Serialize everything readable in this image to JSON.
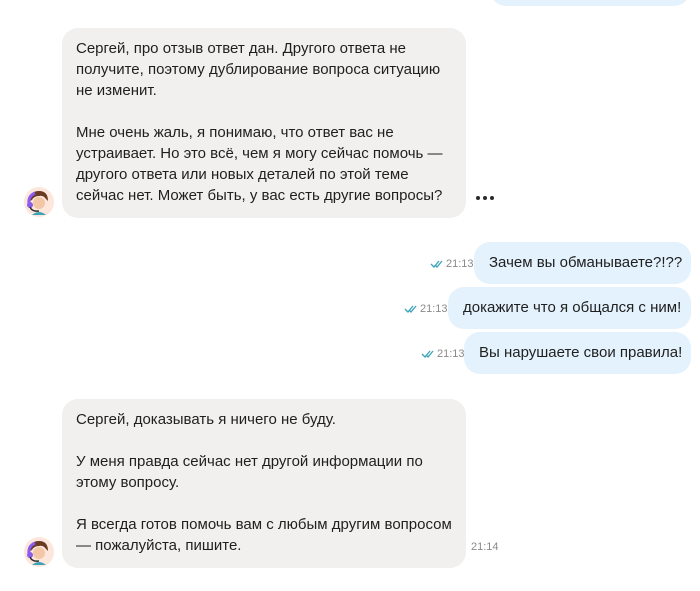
{
  "colors": {
    "incoming_bubble": "#f1f0ee",
    "outgoing_bubble": "#e3f2fc",
    "read_check": "#3aa3b8",
    "timestamp": "#8a8a8a"
  },
  "messages": [
    {
      "direction": "in",
      "text": "Сергей, про отзыв ответ дан. Другого ответа не получите, поэтому дублирование вопроса ситуацию не изменит.\n\nМне очень жаль, я понимаю, что ответ вас не устраивает. Но это всё, чем я могу сейчас помочь — другого ответа или новых деталей по этой теме сейчас нет. Может быть, у вас есть другие вопросы?",
      "more_icon": "more-dots-icon"
    },
    {
      "direction": "out",
      "text": "Зачем вы обманываете?!??",
      "time": "21:13",
      "status_icon": "double-check-icon"
    },
    {
      "direction": "out",
      "text": "докажите что я общался с ним!",
      "time": "21:13",
      "status_icon": "double-check-icon"
    },
    {
      "direction": "out",
      "text": "Вы нарушаете свои правила!",
      "time": "21:13",
      "status_icon": "double-check-icon"
    },
    {
      "direction": "in",
      "text": "Сергей, доказывать я ничего не буду.\n\nУ меня правда сейчас нет другой информации по этому вопросу.\n\nЯ всегда готов помочь вам с любым другим вопросом — пожалуйста, пишите.",
      "time": "21:14"
    }
  ]
}
